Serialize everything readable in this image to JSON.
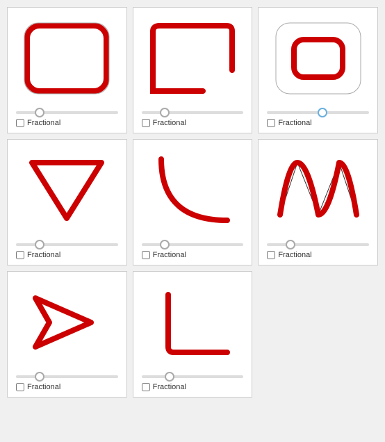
{
  "cards": [
    {
      "id": "rounded-rect-full",
      "label": "Fractional",
      "slider_value": 20,
      "slider_active": false,
      "checked": false
    },
    {
      "id": "rounded-rect-partial",
      "label": "Fractional",
      "slider_value": 20,
      "slider_active": false,
      "checked": false
    },
    {
      "id": "rounded-rect-small",
      "label": "Fractional",
      "slider_value": 55,
      "slider_active": true,
      "checked": false
    },
    {
      "id": "triangle",
      "label": "Fractional",
      "slider_value": 20,
      "slider_active": false,
      "checked": false
    },
    {
      "id": "curve",
      "label": "Fractional",
      "slider_value": 20,
      "slider_active": false,
      "checked": false
    },
    {
      "id": "wave",
      "label": "Fractional",
      "slider_value": 20,
      "slider_active": false,
      "checked": false
    },
    {
      "id": "arrow",
      "label": "Fractional",
      "slider_value": 20,
      "slider_active": false,
      "checked": false
    },
    {
      "id": "corner",
      "label": "Fractional",
      "slider_value": 25,
      "slider_active": false,
      "checked": false
    }
  ]
}
